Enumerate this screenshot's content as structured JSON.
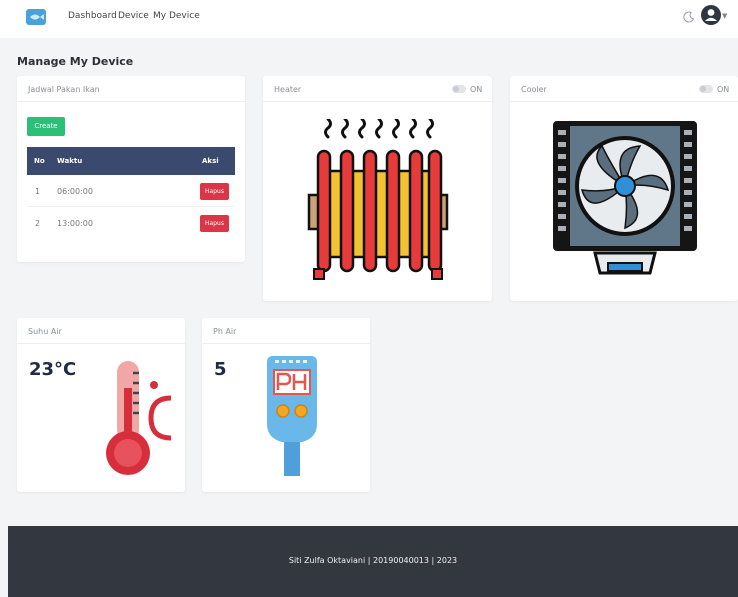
{
  "nav": {
    "dashboard": "Dashboard",
    "device": "Device",
    "my_device": "My Device"
  },
  "page": {
    "title": "Manage My Device"
  },
  "schedule": {
    "title": "Jadwal Pakan Ikan",
    "create_label": "Create",
    "columns": [
      "No",
      "Waktu",
      "Aksi"
    ],
    "rows": [
      {
        "no": "1",
        "waktu": "06:00:00",
        "aksi": "Hapus"
      },
      {
        "no": "2",
        "waktu": "13:00:00",
        "aksi": "Hapus"
      }
    ]
  },
  "heater": {
    "title": "Heater",
    "toggle_label": "ON",
    "icon": "heater-icon"
  },
  "cooler": {
    "title": "Cooler",
    "toggle_label": "ON",
    "icon": "cooler-fan-icon"
  },
  "suhu": {
    "title": "Suhu Air",
    "value": "23°C",
    "icon": "thermometer-icon"
  },
  "ph": {
    "title": "Ph Air",
    "value": "5",
    "icon": "ph-meter-icon"
  },
  "footer": {
    "text": "Siti Zulfa Oktaviani | 20190040013 | 2023"
  },
  "colors": {
    "primary_dark": "#3a4a6e",
    "create_green": "#2bbf78",
    "danger_red": "#dc3545",
    "footer_bg": "#33373f"
  }
}
